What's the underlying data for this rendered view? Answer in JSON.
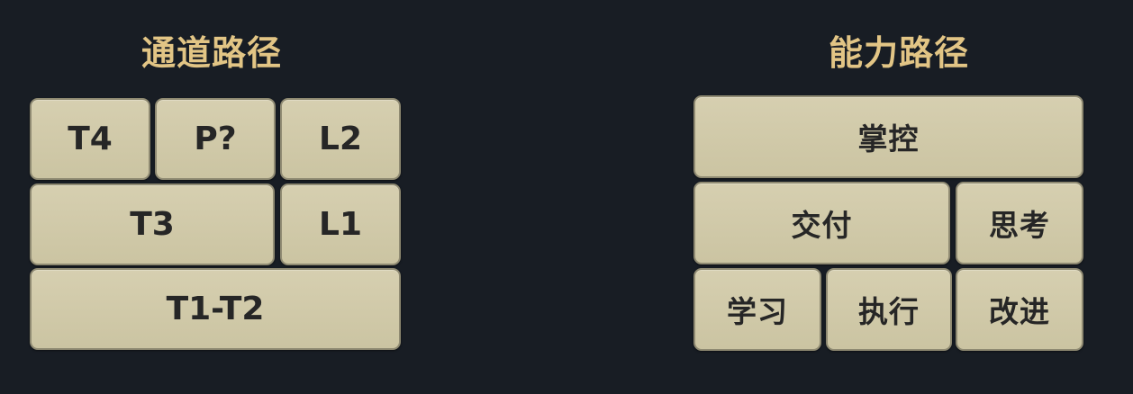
{
  "channel_path": {
    "title": "通道路径",
    "blocks": {
      "t4": "T4",
      "p": "P?",
      "l2": "L2",
      "t3": "T3",
      "l1": "L1",
      "t1t2": "T1-T2"
    }
  },
  "ability_path": {
    "title": "能力路径",
    "blocks": {
      "control": "掌控",
      "deliver": "交付",
      "think": "思考",
      "learn": "学习",
      "execute": "执行",
      "improve": "改进"
    }
  },
  "colors": {
    "background": "#181d24",
    "title": "#e2c585",
    "block_fill": "#d6cfb0",
    "block_text": "#262626"
  }
}
